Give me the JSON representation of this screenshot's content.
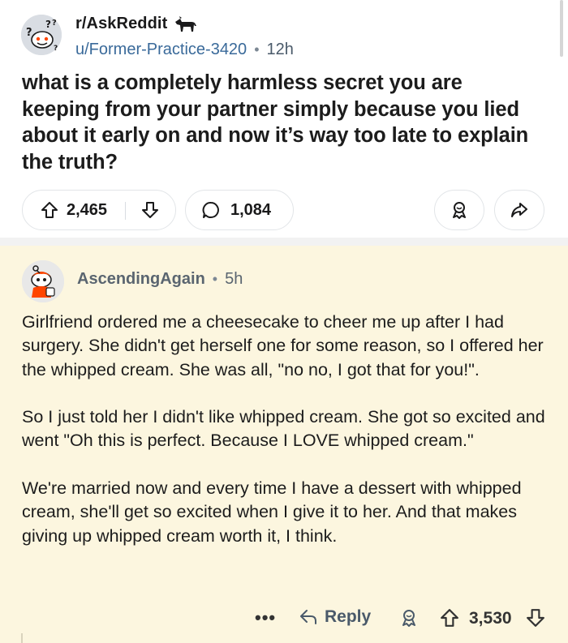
{
  "post": {
    "subreddit": "r/AskReddit",
    "author": "u/Former-Practice-3420",
    "separator": "•",
    "age": "12h",
    "title": "what is a completely harmless secret you are keeping from your partner simply because you lied about it early on and now it’s way too late to explain the truth?",
    "upvotes": "2,465",
    "comments": "1,084",
    "icons": {
      "subreddit": "askreddit-snoo-icon",
      "award": "award-icon",
      "upvote": "upvote-arrow-icon",
      "downvote": "downvote-arrow-icon",
      "comment": "comment-bubble-icon",
      "share": "share-arrow-icon"
    }
  },
  "comment": {
    "author": "AscendingAgain",
    "separator": "•",
    "age": "5h",
    "paragraphs": [
      "Girlfriend ordered me a cheesecake to cheer me up after I had surgery. She didn't get herself one for some reason, so I offered her the whipped cream. She was all, \"no no, I got that for you!\".",
      "So I just told her I didn't like whipped cream. She got so excited and went \"Oh this is perfect. Because I LOVE whipped cream.\"",
      "We're married now and every time I have a dessert with whipped cream, she'll get so excited when I give it to her. And that makes giving up whipped cream worth it, I think."
    ],
    "more_label": "•••",
    "reply_label": "Reply",
    "score": "3,530"
  },
  "colors": {
    "comment_bg": "#fcf6df",
    "link_blue": "#3a6a9a",
    "border": "#e2e5e8"
  }
}
